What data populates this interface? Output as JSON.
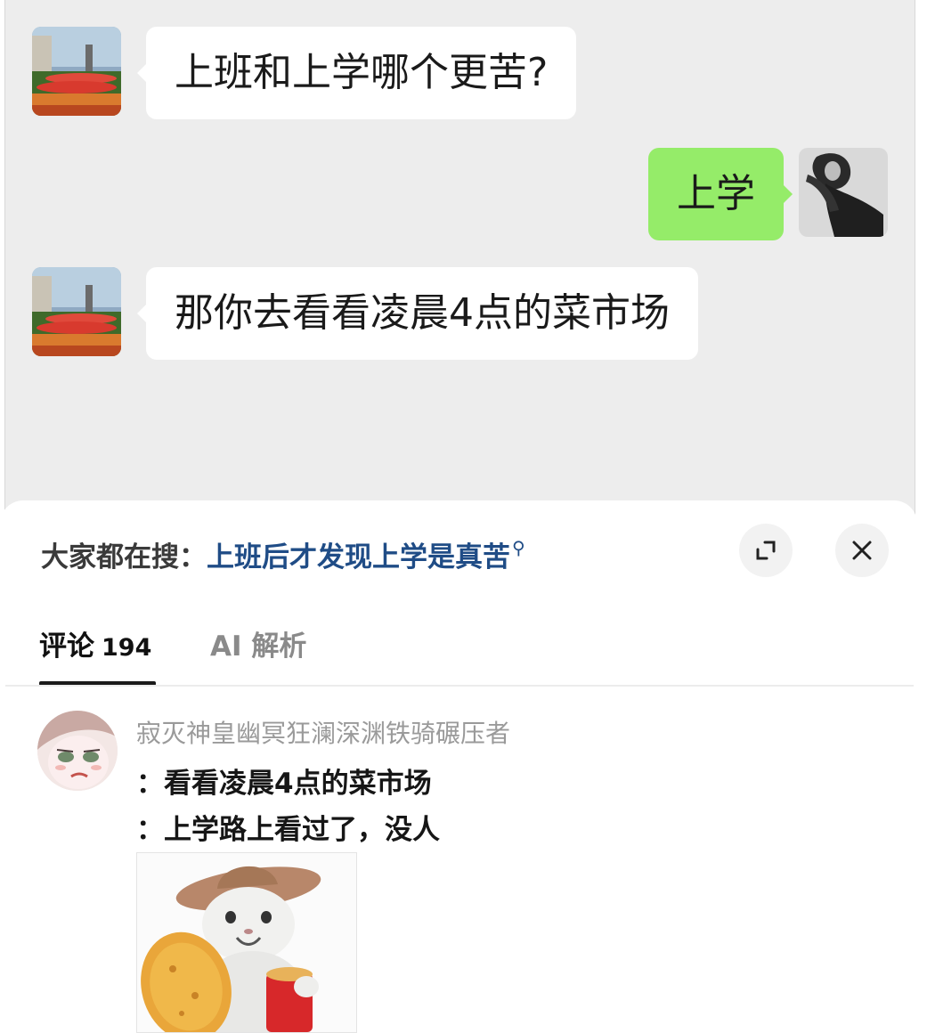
{
  "chat": {
    "messages": [
      {
        "side": "left",
        "text": "上班和上学哪个更苦?"
      },
      {
        "side": "right",
        "text": "上学"
      },
      {
        "side": "left",
        "text": "那你去看看凌晨4点的菜市场"
      }
    ]
  },
  "sheet": {
    "search_prefix": "大家都在搜：",
    "search_term": "上班后才发现上学是真苦",
    "search_icon": "magnifier-icon",
    "expand_icon": "expand-icon",
    "close_icon": "close-icon"
  },
  "tabs": {
    "comments_label": "评论",
    "comments_count": "194",
    "ai_label": "AI 解析"
  },
  "comment": {
    "username": "寂灭神皇幽冥狂澜深渊铁骑碾压者",
    "quote_line": "：看看凌晨4点的菜市场",
    "reply_line": "：上学路上看过了，没人"
  },
  "colors": {
    "chat_background": "#ededed",
    "sent_bubble": "#95ec69",
    "search_term": "#1f4c86"
  }
}
